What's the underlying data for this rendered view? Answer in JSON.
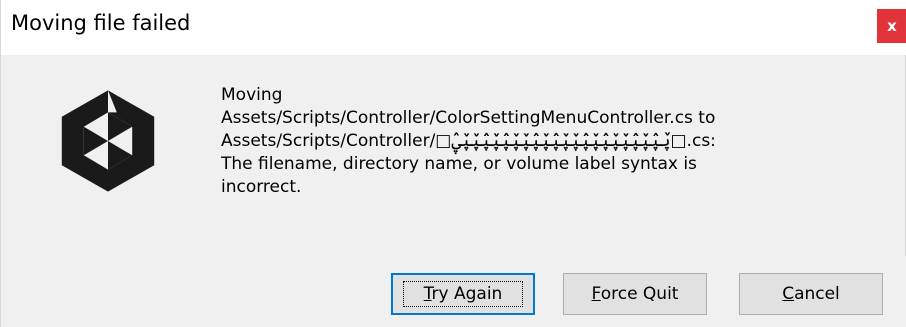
{
  "window": {
    "title": "Moving file failed",
    "close_label": "x"
  },
  "message": {
    "lines": [
      "Moving",
      "Assets/Scripts/Controller/ColorSettingMenuController.cs to",
      "Assets/Scripts/Controller/□ۑ̌ۑ̂ۑ̌ۑ̂ۑ̌ۑ̌ۑ̂ۑ̌ۑ̂ۑ̌ۑ̌ۑ̂ۑ̌ۑ̂ۑ̌ۑ̌ۑ̂ۑ̌ۑ̂ۑ̌ۑ̌ۑ̂□.cs:",
      "The filename, directory name, or volume label syntax is",
      "incorrect."
    ]
  },
  "buttons": {
    "try_again": {
      "accel": "T",
      "rest": "ry Again"
    },
    "force_quit": {
      "accel": "F",
      "rest": "orce Quit"
    },
    "cancel": {
      "accel": "C",
      "rest": "ancel"
    }
  },
  "icons": {
    "logo": "unity-logo-icon"
  }
}
